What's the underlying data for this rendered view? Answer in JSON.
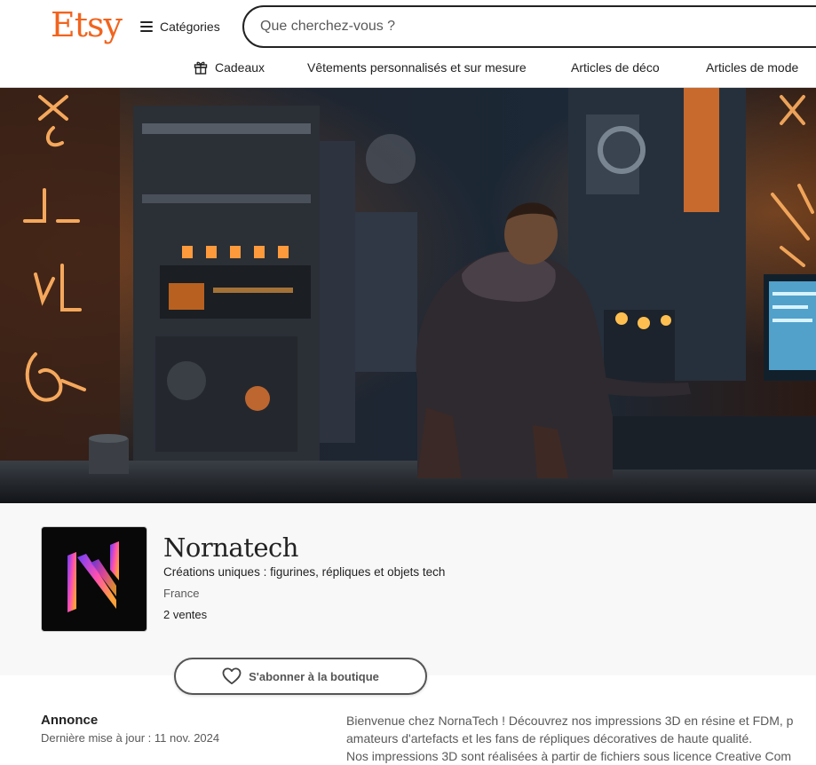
{
  "header": {
    "logo": "Etsy",
    "categories_label": "Catégories",
    "search_placeholder": "Que cherchez-vous ?",
    "nav": [
      "Cadeaux",
      "Vêtements personnalisés et sur mesure",
      "Articles de déco",
      "Articles de mode"
    ]
  },
  "shop": {
    "name": "Nornatech",
    "tagline": "Créations uniques : figurines, répliques et objets tech",
    "country": "France",
    "sales": "2 ventes",
    "follow_label": "S'abonner à la boutique"
  },
  "announcement": {
    "title": "Annonce",
    "updated": "Dernière mise à jour : 11 nov. 2024",
    "lines": [
      "Bienvenue chez NornaTech ! Découvrez nos impressions 3D en résine et FDM, p",
      "amateurs d'artefacts et les fans de répliques décoratives de haute qualité.",
      "Nos impressions 3D sont réalisées à partir de fichiers sous licence Creative Com"
    ]
  },
  "colors": {
    "brand": "#F1641E",
    "logo_gradient": [
      "#6a3cff",
      "#ff4fb0",
      "#ffa03a"
    ]
  },
  "icons": {
    "categories": "hamburger-icon",
    "gift": "gift-icon",
    "follow": "heart-icon"
  }
}
